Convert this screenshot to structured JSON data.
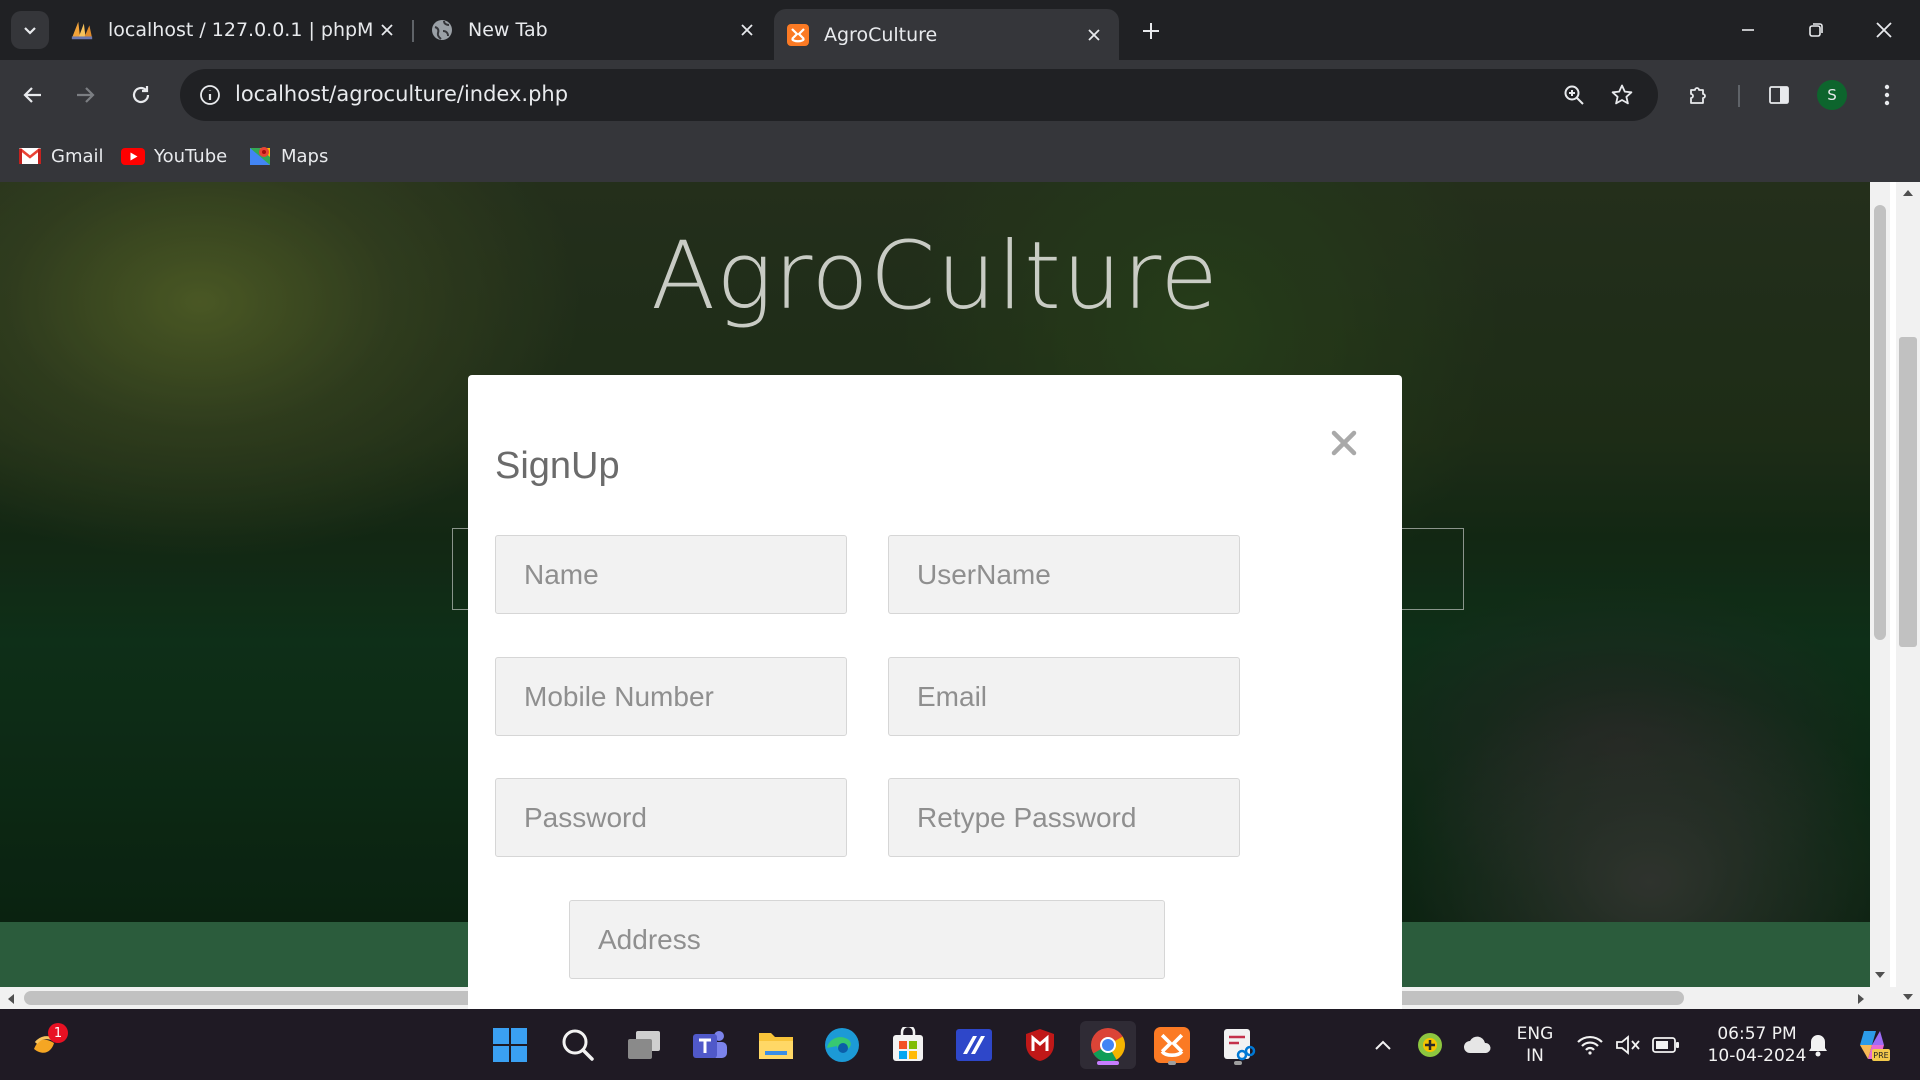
{
  "browser": {
    "tabs": [
      {
        "title": "localhost / 127.0.0.1 | phpMyAdmin",
        "favicon": "phpmyadmin-icon"
      },
      {
        "title": "New Tab",
        "favicon": "globe-icon"
      },
      {
        "title": "AgroCulture",
        "favicon": "xampp-icon",
        "active": true
      }
    ],
    "url": "localhost/agroculture/index.php",
    "profile_initial": "S",
    "bookmarks": [
      {
        "label": "Gmail",
        "icon": "gmail-icon"
      },
      {
        "label": "YouTube",
        "icon": "youtube-icon"
      },
      {
        "label": "Maps",
        "icon": "maps-icon"
      }
    ]
  },
  "page": {
    "site_title": "AgroCulture",
    "modal": {
      "title": "SignUp",
      "fields": {
        "name": "Name",
        "username": "UserName",
        "mobile": "Mobile Number",
        "email": "Email",
        "password": "Password",
        "retype_password": "Retype Password",
        "address": "Address"
      }
    }
  },
  "taskbar": {
    "notification_badge": "1",
    "language": "ENG",
    "region": "IN",
    "time": "06:57 PM",
    "date": "10-04-2024"
  },
  "colors": {
    "chrome_dark": "#202124",
    "chrome_toolbar": "#35363a",
    "green_band": "#2b5c3c",
    "taskbar": "#1f1a24"
  }
}
